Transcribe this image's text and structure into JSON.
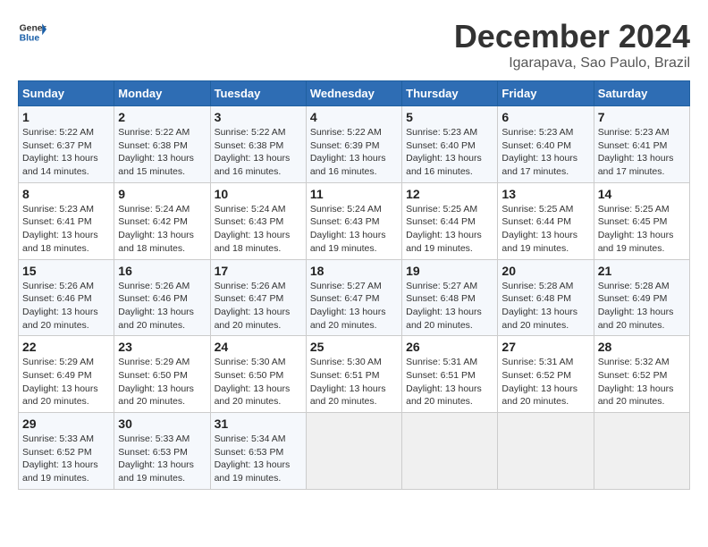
{
  "header": {
    "logo_line1": "General",
    "logo_line2": "Blue",
    "title": "December 2024",
    "subtitle": "Igarapava, Sao Paulo, Brazil"
  },
  "weekdays": [
    "Sunday",
    "Monday",
    "Tuesday",
    "Wednesday",
    "Thursday",
    "Friday",
    "Saturday"
  ],
  "weeks": [
    [
      {
        "day": "1",
        "sunrise": "5:22 AM",
        "sunset": "6:37 PM",
        "daylight": "13 hours and 14 minutes."
      },
      {
        "day": "2",
        "sunrise": "5:22 AM",
        "sunset": "6:38 PM",
        "daylight": "13 hours and 15 minutes."
      },
      {
        "day": "3",
        "sunrise": "5:22 AM",
        "sunset": "6:38 PM",
        "daylight": "13 hours and 16 minutes."
      },
      {
        "day": "4",
        "sunrise": "5:22 AM",
        "sunset": "6:39 PM",
        "daylight": "13 hours and 16 minutes."
      },
      {
        "day": "5",
        "sunrise": "5:23 AM",
        "sunset": "6:40 PM",
        "daylight": "13 hours and 16 minutes."
      },
      {
        "day": "6",
        "sunrise": "5:23 AM",
        "sunset": "6:40 PM",
        "daylight": "13 hours and 17 minutes."
      },
      {
        "day": "7",
        "sunrise": "5:23 AM",
        "sunset": "6:41 PM",
        "daylight": "13 hours and 17 minutes."
      }
    ],
    [
      {
        "day": "8",
        "sunrise": "5:23 AM",
        "sunset": "6:41 PM",
        "daylight": "13 hours and 18 minutes."
      },
      {
        "day": "9",
        "sunrise": "5:24 AM",
        "sunset": "6:42 PM",
        "daylight": "13 hours and 18 minutes."
      },
      {
        "day": "10",
        "sunrise": "5:24 AM",
        "sunset": "6:43 PM",
        "daylight": "13 hours and 18 minutes."
      },
      {
        "day": "11",
        "sunrise": "5:24 AM",
        "sunset": "6:43 PM",
        "daylight": "13 hours and 19 minutes."
      },
      {
        "day": "12",
        "sunrise": "5:25 AM",
        "sunset": "6:44 PM",
        "daylight": "13 hours and 19 minutes."
      },
      {
        "day": "13",
        "sunrise": "5:25 AM",
        "sunset": "6:44 PM",
        "daylight": "13 hours and 19 minutes."
      },
      {
        "day": "14",
        "sunrise": "5:25 AM",
        "sunset": "6:45 PM",
        "daylight": "13 hours and 19 minutes."
      }
    ],
    [
      {
        "day": "15",
        "sunrise": "5:26 AM",
        "sunset": "6:46 PM",
        "daylight": "13 hours and 20 minutes."
      },
      {
        "day": "16",
        "sunrise": "5:26 AM",
        "sunset": "6:46 PM",
        "daylight": "13 hours and 20 minutes."
      },
      {
        "day": "17",
        "sunrise": "5:26 AM",
        "sunset": "6:47 PM",
        "daylight": "13 hours and 20 minutes."
      },
      {
        "day": "18",
        "sunrise": "5:27 AM",
        "sunset": "6:47 PM",
        "daylight": "13 hours and 20 minutes."
      },
      {
        "day": "19",
        "sunrise": "5:27 AM",
        "sunset": "6:48 PM",
        "daylight": "13 hours and 20 minutes."
      },
      {
        "day": "20",
        "sunrise": "5:28 AM",
        "sunset": "6:48 PM",
        "daylight": "13 hours and 20 minutes."
      },
      {
        "day": "21",
        "sunrise": "5:28 AM",
        "sunset": "6:49 PM",
        "daylight": "13 hours and 20 minutes."
      }
    ],
    [
      {
        "day": "22",
        "sunrise": "5:29 AM",
        "sunset": "6:49 PM",
        "daylight": "13 hours and 20 minutes."
      },
      {
        "day": "23",
        "sunrise": "5:29 AM",
        "sunset": "6:50 PM",
        "daylight": "13 hours and 20 minutes."
      },
      {
        "day": "24",
        "sunrise": "5:30 AM",
        "sunset": "6:50 PM",
        "daylight": "13 hours and 20 minutes."
      },
      {
        "day": "25",
        "sunrise": "5:30 AM",
        "sunset": "6:51 PM",
        "daylight": "13 hours and 20 minutes."
      },
      {
        "day": "26",
        "sunrise": "5:31 AM",
        "sunset": "6:51 PM",
        "daylight": "13 hours and 20 minutes."
      },
      {
        "day": "27",
        "sunrise": "5:31 AM",
        "sunset": "6:52 PM",
        "daylight": "13 hours and 20 minutes."
      },
      {
        "day": "28",
        "sunrise": "5:32 AM",
        "sunset": "6:52 PM",
        "daylight": "13 hours and 20 minutes."
      }
    ],
    [
      {
        "day": "29",
        "sunrise": "5:33 AM",
        "sunset": "6:52 PM",
        "daylight": "13 hours and 19 minutes."
      },
      {
        "day": "30",
        "sunrise": "5:33 AM",
        "sunset": "6:53 PM",
        "daylight": "13 hours and 19 minutes."
      },
      {
        "day": "31",
        "sunrise": "5:34 AM",
        "sunset": "6:53 PM",
        "daylight": "13 hours and 19 minutes."
      },
      null,
      null,
      null,
      null
    ]
  ],
  "labels": {
    "sunrise": "Sunrise:",
    "sunset": "Sunset:",
    "daylight": "Daylight:"
  }
}
